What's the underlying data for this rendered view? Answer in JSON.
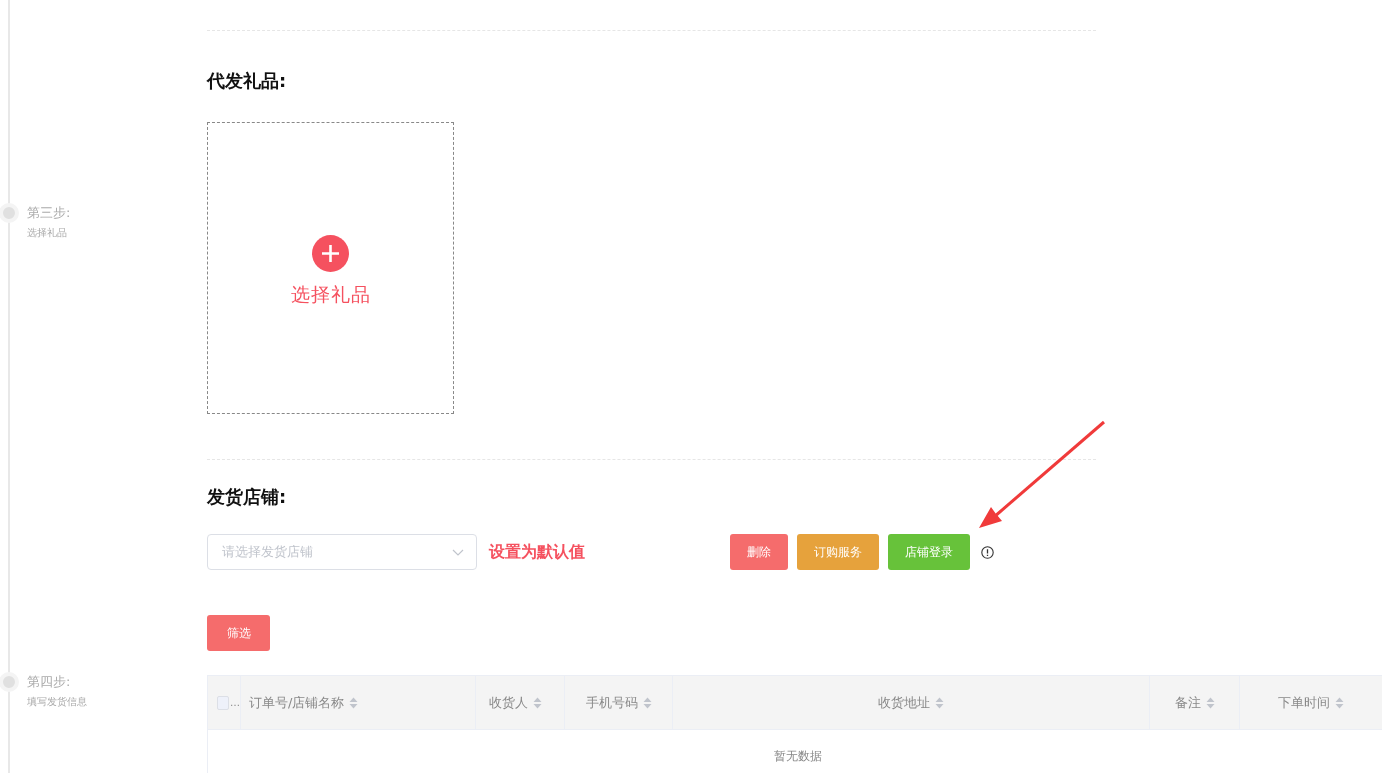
{
  "steps": [
    {
      "title": "第三步:",
      "subtitle": "选择礼品"
    },
    {
      "title": "第四步:",
      "subtitle": "填写发货信息"
    }
  ],
  "gift_section": {
    "heading": "代发礼品:",
    "upload_label": "选择礼品"
  },
  "shop_section": {
    "heading": "发货店铺:",
    "select": {
      "placeholder": "请选择发货店铺"
    },
    "default_note": "设置为默认值",
    "buttons": [
      {
        "label": "删除",
        "color": "#f56c6c"
      },
      {
        "label": "订购服务",
        "color": "#e6a23c"
      },
      {
        "label": "店铺登录",
        "color": "#67c23a"
      }
    ]
  },
  "filter_button": "筛选",
  "table": {
    "checkbox": {
      "checked": false,
      "label": "…"
    },
    "columns": [
      {
        "label": "订单号/店铺名称"
      },
      {
        "label": "收货人"
      },
      {
        "label": "手机号码"
      },
      {
        "label": "收货地址"
      },
      {
        "label": "备注"
      },
      {
        "label": "下单时间"
      }
    ],
    "empty_text": "暂无数据"
  }
}
